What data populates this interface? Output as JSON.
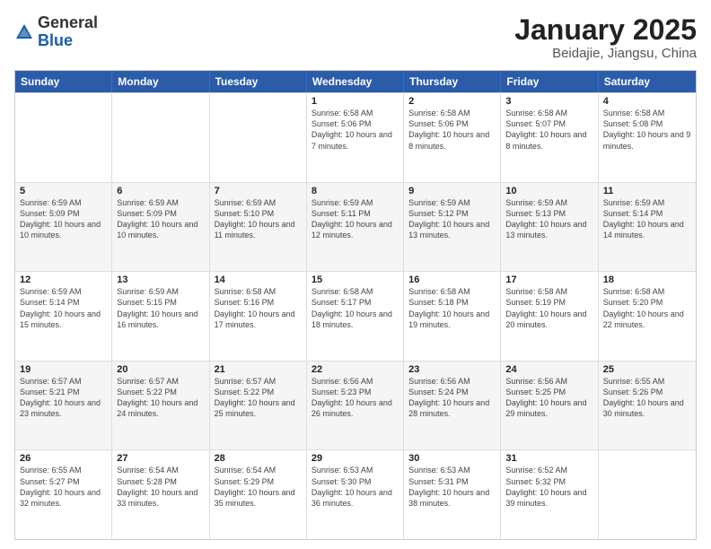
{
  "header": {
    "logo_general": "General",
    "logo_blue": "Blue",
    "title": "January 2025",
    "subtitle": "Beidajie, Jiangsu, China"
  },
  "days_of_week": [
    "Sunday",
    "Monday",
    "Tuesday",
    "Wednesday",
    "Thursday",
    "Friday",
    "Saturday"
  ],
  "weeks": [
    [
      {
        "day": "",
        "info": ""
      },
      {
        "day": "",
        "info": ""
      },
      {
        "day": "",
        "info": ""
      },
      {
        "day": "1",
        "info": "Sunrise: 6:58 AM\nSunset: 5:06 PM\nDaylight: 10 hours\nand 7 minutes."
      },
      {
        "day": "2",
        "info": "Sunrise: 6:58 AM\nSunset: 5:06 PM\nDaylight: 10 hours\nand 8 minutes."
      },
      {
        "day": "3",
        "info": "Sunrise: 6:58 AM\nSunset: 5:07 PM\nDaylight: 10 hours\nand 8 minutes."
      },
      {
        "day": "4",
        "info": "Sunrise: 6:58 AM\nSunset: 5:08 PM\nDaylight: 10 hours\nand 9 minutes."
      }
    ],
    [
      {
        "day": "5",
        "info": "Sunrise: 6:59 AM\nSunset: 5:09 PM\nDaylight: 10 hours\nand 10 minutes."
      },
      {
        "day": "6",
        "info": "Sunrise: 6:59 AM\nSunset: 5:09 PM\nDaylight: 10 hours\nand 10 minutes."
      },
      {
        "day": "7",
        "info": "Sunrise: 6:59 AM\nSunset: 5:10 PM\nDaylight: 10 hours\nand 11 minutes."
      },
      {
        "day": "8",
        "info": "Sunrise: 6:59 AM\nSunset: 5:11 PM\nDaylight: 10 hours\nand 12 minutes."
      },
      {
        "day": "9",
        "info": "Sunrise: 6:59 AM\nSunset: 5:12 PM\nDaylight: 10 hours\nand 13 minutes."
      },
      {
        "day": "10",
        "info": "Sunrise: 6:59 AM\nSunset: 5:13 PM\nDaylight: 10 hours\nand 13 minutes."
      },
      {
        "day": "11",
        "info": "Sunrise: 6:59 AM\nSunset: 5:14 PM\nDaylight: 10 hours\nand 14 minutes."
      }
    ],
    [
      {
        "day": "12",
        "info": "Sunrise: 6:59 AM\nSunset: 5:14 PM\nDaylight: 10 hours\nand 15 minutes."
      },
      {
        "day": "13",
        "info": "Sunrise: 6:59 AM\nSunset: 5:15 PM\nDaylight: 10 hours\nand 16 minutes."
      },
      {
        "day": "14",
        "info": "Sunrise: 6:58 AM\nSunset: 5:16 PM\nDaylight: 10 hours\nand 17 minutes."
      },
      {
        "day": "15",
        "info": "Sunrise: 6:58 AM\nSunset: 5:17 PM\nDaylight: 10 hours\nand 18 minutes."
      },
      {
        "day": "16",
        "info": "Sunrise: 6:58 AM\nSunset: 5:18 PM\nDaylight: 10 hours\nand 19 minutes."
      },
      {
        "day": "17",
        "info": "Sunrise: 6:58 AM\nSunset: 5:19 PM\nDaylight: 10 hours\nand 20 minutes."
      },
      {
        "day": "18",
        "info": "Sunrise: 6:58 AM\nSunset: 5:20 PM\nDaylight: 10 hours\nand 22 minutes."
      }
    ],
    [
      {
        "day": "19",
        "info": "Sunrise: 6:57 AM\nSunset: 5:21 PM\nDaylight: 10 hours\nand 23 minutes."
      },
      {
        "day": "20",
        "info": "Sunrise: 6:57 AM\nSunset: 5:22 PM\nDaylight: 10 hours\nand 24 minutes."
      },
      {
        "day": "21",
        "info": "Sunrise: 6:57 AM\nSunset: 5:22 PM\nDaylight: 10 hours\nand 25 minutes."
      },
      {
        "day": "22",
        "info": "Sunrise: 6:56 AM\nSunset: 5:23 PM\nDaylight: 10 hours\nand 26 minutes."
      },
      {
        "day": "23",
        "info": "Sunrise: 6:56 AM\nSunset: 5:24 PM\nDaylight: 10 hours\nand 28 minutes."
      },
      {
        "day": "24",
        "info": "Sunrise: 6:56 AM\nSunset: 5:25 PM\nDaylight: 10 hours\nand 29 minutes."
      },
      {
        "day": "25",
        "info": "Sunrise: 6:55 AM\nSunset: 5:26 PM\nDaylight: 10 hours\nand 30 minutes."
      }
    ],
    [
      {
        "day": "26",
        "info": "Sunrise: 6:55 AM\nSunset: 5:27 PM\nDaylight: 10 hours\nand 32 minutes."
      },
      {
        "day": "27",
        "info": "Sunrise: 6:54 AM\nSunset: 5:28 PM\nDaylight: 10 hours\nand 33 minutes."
      },
      {
        "day": "28",
        "info": "Sunrise: 6:54 AM\nSunset: 5:29 PM\nDaylight: 10 hours\nand 35 minutes."
      },
      {
        "day": "29",
        "info": "Sunrise: 6:53 AM\nSunset: 5:30 PM\nDaylight: 10 hours\nand 36 minutes."
      },
      {
        "day": "30",
        "info": "Sunrise: 6:53 AM\nSunset: 5:31 PM\nDaylight: 10 hours\nand 38 minutes."
      },
      {
        "day": "31",
        "info": "Sunrise: 6:52 AM\nSunset: 5:32 PM\nDaylight: 10 hours\nand 39 minutes."
      },
      {
        "day": "",
        "info": ""
      }
    ]
  ],
  "alt_rows": [
    1,
    3
  ]
}
